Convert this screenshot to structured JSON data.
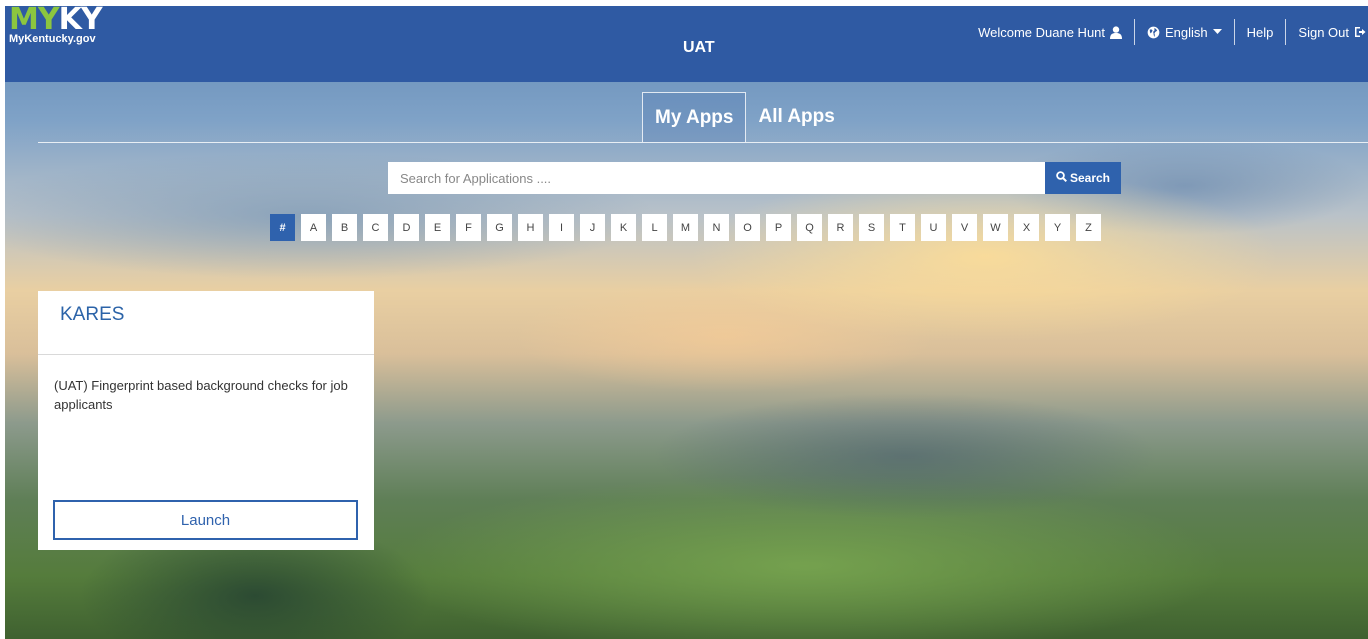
{
  "header": {
    "logo_my": "MY",
    "logo_ky": "KY",
    "logo_sub": "MyKentucky.gov",
    "env_title": "UAT",
    "welcome": "Welcome Duane Hunt",
    "language": "English",
    "help": "Help",
    "sign_out": "Sign Out"
  },
  "tabs": {
    "my_apps": "My Apps",
    "all_apps": "All Apps"
  },
  "search": {
    "placeholder": "Search for Applications ....",
    "button_label": "Search"
  },
  "alphabet": [
    "#",
    "A",
    "B",
    "C",
    "D",
    "E",
    "F",
    "G",
    "H",
    "I",
    "J",
    "K",
    "L",
    "M",
    "N",
    "O",
    "P",
    "Q",
    "R",
    "S",
    "T",
    "U",
    "V",
    "W",
    "X",
    "Y",
    "Z"
  ],
  "app_card": {
    "title": "KARES",
    "description": "(UAT) Fingerprint based background checks for job applicants",
    "launch_label": "Launch"
  },
  "colors": {
    "header_bg": "#2f5aa3",
    "accent": "#2f62ad",
    "logo_green": "#8cc63f"
  },
  "icons": [
    "user-icon",
    "globe-icon",
    "caret-down-icon",
    "sign-out-icon",
    "search-icon"
  ]
}
